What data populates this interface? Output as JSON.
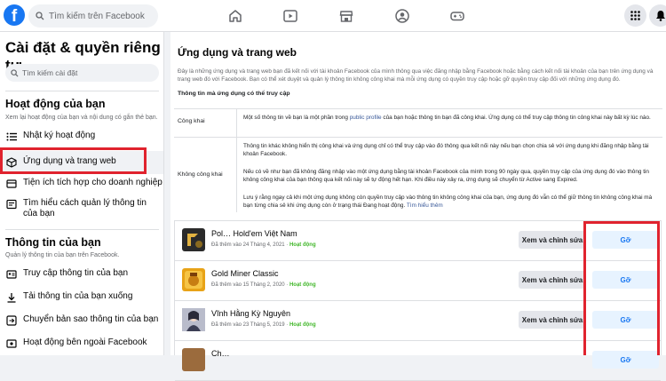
{
  "topbar": {
    "logo": "f",
    "search_placeholder": "Tìm kiếm trên Facebook",
    "nav_icons": [
      "home-icon",
      "watch-icon",
      "marketplace-icon",
      "groups-icon",
      "gaming-icon"
    ],
    "right_icons": [
      "menu-grid-icon",
      "notifications-icon"
    ]
  },
  "sidebar": {
    "title": "Cài đặt & quyền riêng tư",
    "search_placeholder": "Tìm kiếm cài đặt",
    "section1": {
      "heading": "Hoạt động của bạn",
      "desc": "Xem lại hoạt động của bạn và nội dung có gắn thẻ bạn.",
      "items": [
        {
          "label": "Nhật ký hoạt động",
          "icon": "list-icon"
        },
        {
          "label": "Ứng dụng và trang web",
          "icon": "cube-icon"
        },
        {
          "label": "Tiện ích tích hợp cho doanh nghiệp",
          "icon": "business-integrations-icon"
        },
        {
          "label": "Tìm hiểu cách quản lý thông tin của bạn",
          "icon": "info-icon"
        }
      ]
    },
    "section2": {
      "heading": "Thông tin của bạn",
      "desc": "Quản lý thông tin của bạn trên Facebook.",
      "items": [
        {
          "label": "Truy cập thông tin của bạn",
          "icon": "access-info-icon"
        },
        {
          "label": "Tải thông tin của bạn xuống",
          "icon": "download-icon"
        },
        {
          "label": "Chuyển bản sao thông tin của bạn",
          "icon": "transfer-icon"
        },
        {
          "label": "Hoạt động bên ngoài Facebook",
          "icon": "off-facebook-icon"
        }
      ]
    }
  },
  "main": {
    "title": "Ứng dụng và trang web",
    "intro": "Đây là những ứng dụng và trang web bạn đã kết nối với tài khoản Facebook của mình thông qua việc đăng nhập bằng Facebook hoặc bằng cách kết nối tài khoản của bạn trên ứng dụng và trang web đó với Facebook. Bạn có thể xét duyệt và quản lý thông tin không công khai mà mỗi ứng dụng có quyền truy cập hoặc gỡ quyền truy cập đối với những ứng dụng đó.",
    "subheading": "Thông tin mà ứng dụng có thể truy cập",
    "public_label": "Công khai",
    "public_text_a": "Một số thông tin về bạn là một phần trong ",
    "public_link": "public profile",
    "public_text_b": " của bạn hoặc thông tin bạn đã công khai. Ứng dụng có thể truy cập thông tin công khai này bất kỳ lúc nào.",
    "private_label": "Không công khai",
    "private_p1": "Thông tin khác không hiển thị công khai và ứng dụng chỉ có thể truy cập vào đó thông qua kết nối này nếu bạn chọn chia sẻ với ứng dụng khi đăng nhập bằng tài khoản Facebook.",
    "private_p2": "Nếu có về như bạn đã không đăng nhập vào một ứng dụng bằng tài khoản Facebook của mình trong 90 ngày qua, quyền truy cập của ứng dụng đó vào thông tin không công khai của bạn thông qua kết nối này sẽ tự động hết hạn. Khi điều này xảy ra, ứng dụng sẽ chuyển từ Active sang Expired.",
    "private_p3": "Lưu ý rằng ngay cả khi một ứng dụng không còn quyền truy cập vào thông tin không công khai của bạn, ứng dụng đó vẫn có thể giữ thông tin không công khai mà bạn từng chia sẻ khi ứng dụng còn ở trạng thái Đang hoạt động. ",
    "private_link": "Tìm hiểu thêm",
    "apps": [
      {
        "name": "Pol… Hold'em Việt Nam",
        "added": "Đã thêm vào 24 Tháng 4, 2021",
        "status": "Hoạt động",
        "edit": "Xem và chỉnh sửa",
        "remove": "Gỡ",
        "color": "#2b2b2b"
      },
      {
        "name": "Gold Miner Classic",
        "added": "Đã thêm vào 15 Tháng 2, 2020",
        "status": "Hoạt động",
        "edit": "Xem và chỉnh sửa",
        "remove": "Gỡ",
        "color": "#e8a317"
      },
      {
        "name": "Vĩnh Hằng Kỳ Nguyên",
        "added": "Đã thêm vào 23 Tháng 5, 2019",
        "status": "Hoạt động",
        "edit": "Xem và chỉnh sửa",
        "remove": "Gỡ",
        "color": "#8a8fa3"
      },
      {
        "name": "Ch…",
        "added": "",
        "status": "",
        "edit": "",
        "remove": "Gỡ",
        "color": "#9b6b3d"
      }
    ]
  },
  "colors": {
    "brand": "#1877f2",
    "highlight": "#e0232e",
    "status": "#42b72a"
  }
}
